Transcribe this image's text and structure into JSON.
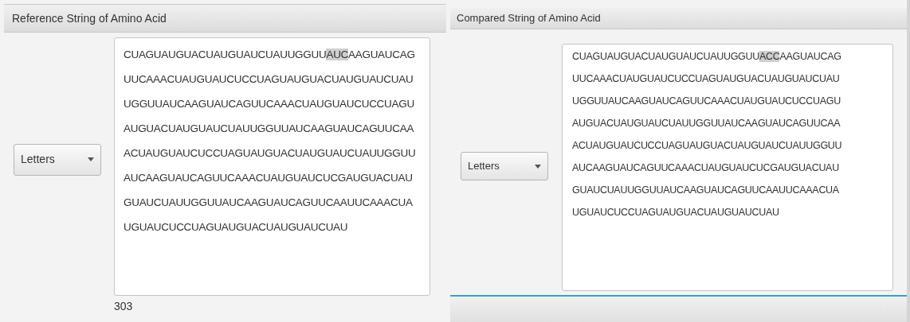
{
  "panels": [
    {
      "title": "Reference String of Amino Acid",
      "dropdown": {
        "value": "Letters"
      },
      "lines": [
        [
          {
            "text": "CUAGUAUGUACUAUGUAUCUAUUGGUU",
            "highlighted": false
          },
          {
            "text": "AUC",
            "highlighted": true
          },
          {
            "text": "AAGUAUCAG",
            "highlighted": false
          }
        ],
        [
          {
            "text": "UUCAAACUAUGUAUCUCCUAGUAUGUACUAUGUAUCUAU",
            "highlighted": false
          }
        ],
        [
          {
            "text": "UGGUUAUCAAGUAUCAGUUCAAACUAUGUAUCUCCUAGU",
            "highlighted": false
          }
        ],
        [
          {
            "text": "AUGUACUAUGUAUCUAUUGGUUAUCAAGUAUCAGUUCAA",
            "highlighted": false
          }
        ],
        [
          {
            "text": "ACUAUGUAUCUCCUAGUAUGUACUAUGUAUCUAUUGGUU",
            "highlighted": false
          }
        ],
        [
          {
            "text": "AUCAAGUAUCAGUUCAAACUAUGUAUCUCGAUGUACUAU",
            "highlighted": false
          }
        ],
        [
          {
            "text": "GUAUCUAUUGGUUAUCAAGUAUCAGUUCAAUUCAAACUA",
            "highlighted": false
          }
        ],
        [
          {
            "text": "UGUAUCUCCUAGUAUGUACUAUGUAUCUAU",
            "highlighted": false
          }
        ]
      ],
      "count": "303"
    },
    {
      "title": "Compared String of Amino Acid",
      "dropdown": {
        "value": "Letters"
      },
      "lines": [
        [
          {
            "text": "CUAGUAUGUACUAUGUAUCUAUUGGUU",
            "highlighted": false
          },
          {
            "text": "ACC",
            "highlighted": true
          },
          {
            "text": "AAGUAUCAG",
            "highlighted": false
          }
        ],
        [
          {
            "text": "UUCAAACUAUGUAUCUCCUAGUAUGUACUAUGUAUCUAU",
            "highlighted": false
          }
        ],
        [
          {
            "text": "UGGUUAUCAAGUAUCAGUUCAAACUAUGUAUCUCCUAGU",
            "highlighted": false
          }
        ],
        [
          {
            "text": "AUGUACUAUGUAUCUAUUGGUUAUCAAGUAUCAGUUCAA",
            "highlighted": false
          }
        ],
        [
          {
            "text": "ACUAUGUAUCUCCUAGUAUGUACUAUGUAUCUAUUGGUU",
            "highlighted": false
          }
        ],
        [
          {
            "text": "AUCAAGUAUCAGUUCAAACUAUGUAUCUCGAUGUACUAU",
            "highlighted": false
          }
        ],
        [
          {
            "text": "GUAUCUAUUGGUUAUCAAGUAUCAGUUCAAUUCAAACUA",
            "highlighted": false
          }
        ],
        [
          {
            "text": "UGUAUCUCCUAGUAUGUACUAUGUAUCUAU",
            "highlighted": false
          }
        ]
      ]
    }
  ]
}
